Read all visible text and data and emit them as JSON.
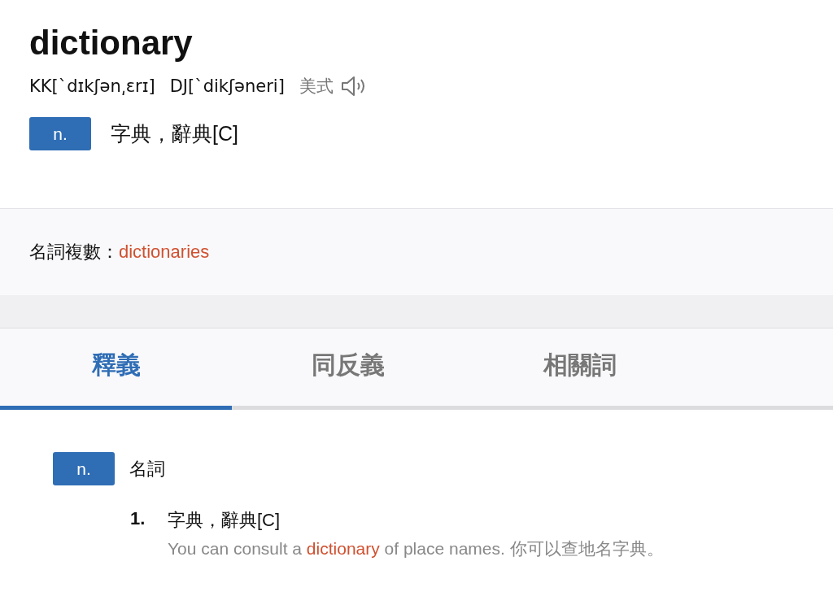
{
  "headword": "dictionary",
  "pronunciation": {
    "kk": "KK[ˋdɪkʃən͵ɛrɪ]",
    "dj": "DJ[ˋdikʃəneri]",
    "accent": "美式"
  },
  "summary": [
    {
      "pos": "n.",
      "meaning": "字典，辭典[C]"
    }
  ],
  "plural": {
    "label": "名詞複數：",
    "word": "dictionaries"
  },
  "tabs": [
    {
      "label": "釋義",
      "selected": true
    },
    {
      "label": "同反義",
      "selected": false
    },
    {
      "label": "相關詞",
      "selected": false
    }
  ],
  "senses": [
    {
      "pos": "n.",
      "pos_name": "名詞",
      "definitions": [
        {
          "number": "1.",
          "meaning": "字典，辭典[C]",
          "example": {
            "before": "You can consult a ",
            "link": "dictionary",
            "after": " of place names. 你可以查地名字典。"
          }
        }
      ]
    }
  ]
}
